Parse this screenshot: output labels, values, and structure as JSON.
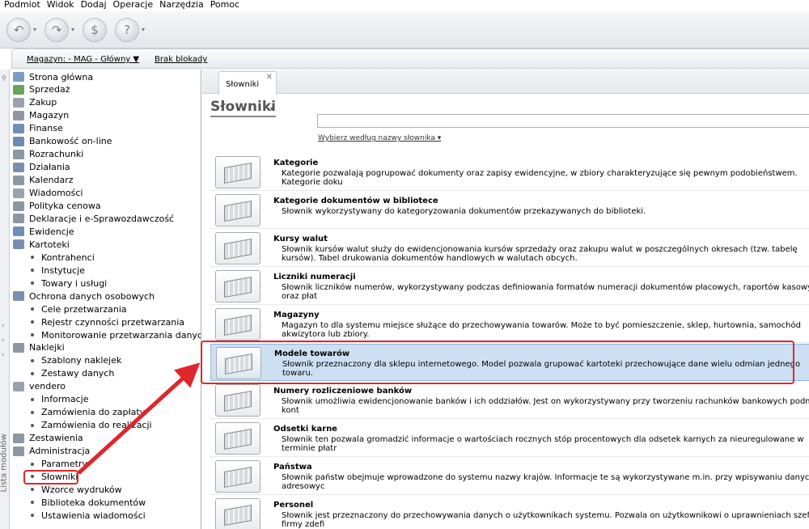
{
  "menu": [
    "Podmiot",
    "Widok",
    "Dodaj",
    "Operacje",
    "Narzędzia",
    "Pomoc"
  ],
  "toolbar": {
    "icons": [
      "back-icon",
      "forward-icon",
      "s-icon",
      "help-icon"
    ]
  },
  "strip": {
    "magazyn": "Magazyn: - MAG - Główny",
    "magazyn_arrow": "▼",
    "blokada": "Brak blokady"
  },
  "vtab": {
    "label": "Lista modułów"
  },
  "sidebar": {
    "items": [
      {
        "label": "Strona główna",
        "sub": false,
        "color": "#7a9cc6"
      },
      {
        "label": "Sprzedaż",
        "sub": false,
        "color": "#6aa35f"
      },
      {
        "label": "Zakup",
        "sub": false,
        "color": "#9aa3ad"
      },
      {
        "label": "Magazyn",
        "sub": false,
        "color": "#8d96a1"
      },
      {
        "label": "Finanse",
        "sub": false,
        "color": "#6f8fb8"
      },
      {
        "label": "Bankowość on-line",
        "sub": false,
        "color": "#6b8db4"
      },
      {
        "label": "Rozrachunki",
        "sub": false,
        "color": "#8d96a1"
      },
      {
        "label": "Działania",
        "sub": false,
        "color": "#7a8fb0"
      },
      {
        "label": "Kalendarz",
        "sub": false,
        "color": "#8d96a1"
      },
      {
        "label": "Wiadomości",
        "sub": false,
        "color": "#9aa3ad"
      },
      {
        "label": "Polityka cenowa",
        "sub": false,
        "color": "#8d96a1"
      },
      {
        "label": "Deklaracje i e-Sprawozdawczość",
        "sub": false,
        "color": "#8d96a1"
      },
      {
        "label": "Ewidencje",
        "sub": false,
        "color": "#6f8fb8"
      },
      {
        "label": "Kartoteki",
        "sub": false,
        "color": "#7a8fb0"
      },
      {
        "label": "Kontrahenci",
        "sub": true
      },
      {
        "label": "Instytucje",
        "sub": true
      },
      {
        "label": "Towary i usługi",
        "sub": true
      },
      {
        "label": "Ochrona danych osobowych",
        "sub": false,
        "color": "#7a8fb0"
      },
      {
        "label": "Cele przetwarzania",
        "sub": true
      },
      {
        "label": "Rejestr czynności przetwarzania",
        "sub": true
      },
      {
        "label": "Monitorowanie przetwarzania danych",
        "sub": true
      },
      {
        "label": "Naklejki",
        "sub": false,
        "color": "#8d96a1"
      },
      {
        "label": "Szablony naklejek",
        "sub": true
      },
      {
        "label": "Zestawy danych",
        "sub": true
      },
      {
        "label": "vendero",
        "sub": false,
        "color": "#9aa3ad"
      },
      {
        "label": "Informacje",
        "sub": true
      },
      {
        "label": "Zamówienia do zapłaty",
        "sub": true
      },
      {
        "label": "Zamówienia do realizacji",
        "sub": true
      },
      {
        "label": "Zestawienia",
        "sub": false,
        "color": "#8d96a1"
      },
      {
        "label": "Administracja",
        "sub": false,
        "color": "#8d96a1"
      },
      {
        "label": "Parametry",
        "sub": true
      },
      {
        "label": "Słowniki",
        "sub": true
      },
      {
        "label": "Wzorce wydruków",
        "sub": true
      },
      {
        "label": "Biblioteka dokumentów",
        "sub": true
      },
      {
        "label": "Ustawienia wiadomości",
        "sub": true
      }
    ]
  },
  "tab": {
    "label": "Słowniki",
    "close": "✕"
  },
  "page": {
    "title": "Słowniki",
    "title_arrow": "▾",
    "filter": "Wybierz według nazwy słownika ▾"
  },
  "rows": [
    {
      "title": "Kategorie",
      "desc": "Kategorie pozwalają pogrupować dokumenty oraz zapisy ewidencyjne, w zbiory charakteryzujące się pewnym podobieństwem. Kategorie doku"
    },
    {
      "title": "Kategorie dokumentów w bibliotece",
      "desc": "Słownik wykorzystywany do kategoryzowania dokumentów przekazywanych do biblioteki."
    },
    {
      "title": "Kursy walut",
      "desc": "Słownik kursów walut służy do ewidencjonowania kursów sprzedaży oraz zakupu walut w poszczególnych okresach (tzw. tabelę kursów). Tabel drukowania dokumentów handlowych w walutach obcych."
    },
    {
      "title": "Liczniki numeracji",
      "desc": "Słownik liczników numerów, wykorzystywany podczas definiowania formatów numeracji dokumentów płacowych, raportów kasowych oraz płat"
    },
    {
      "title": "Magazyny",
      "desc": "Magazyn to dla systemu miejsce służące do przechowywania towarów. Może to być pomieszczenie, sklep, hurtownia, samochód akwizytora lub zbiory."
    },
    {
      "title": "Modele towarów",
      "desc": "Słownik przeznaczony dla sklepu internetowego. Model pozwala grupować kartoteki przechowujące dane wielu odmian jednego towaru."
    },
    {
      "title": "Numery rozliczeniowe banków",
      "desc": "Słownik umożliwia ewidencjonowanie banków i ich oddziałów. Jest on wykorzystywany przy tworzeniu rachunków bankowych podmiotu, kont"
    },
    {
      "title": "Odsetki karne",
      "desc": "Słownik ten pozwala gromadzić informacje o wartościach rocznych stóp procentowych dla odsetek karnych za nieuregulowane w terminie płatr"
    },
    {
      "title": "Państwa",
      "desc": "Słownik państw obejmuje wprowadzone do systemu nazwy krajów. Informacje te są wykorzystywane m.in. przy wpisywaniu danych adresowyc"
    },
    {
      "title": "Personel",
      "desc": "Słownik jest przeznaczony do przechowywania danych o użytkownikach systemu. Pozwala on użytkownikowi o uprawnieniach szefa firmy zdefi"
    }
  ]
}
